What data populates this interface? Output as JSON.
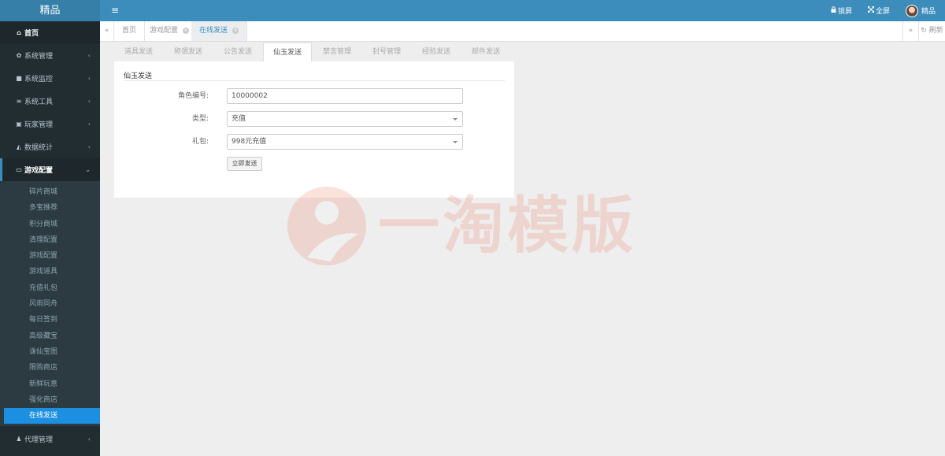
{
  "app": {
    "brand": "精品",
    "menu_icon": "≡",
    "top_actions": [
      {
        "icon": "lock-icon",
        "label": "锁屏"
      },
      {
        "icon": "expand-icon",
        "label": "全屏"
      }
    ],
    "user_name": "精品"
  },
  "sidebar": {
    "home": "首页",
    "groups": [
      {
        "label": "系统管理",
        "icon": "gear-icon"
      },
      {
        "label": "系统监控",
        "icon": "video-icon"
      },
      {
        "label": "系统工具",
        "icon": "bars-icon"
      },
      {
        "label": "玩家管理",
        "icon": "id-card-icon"
      },
      {
        "label": "数据统计",
        "icon": "area-chart-icon"
      }
    ],
    "open_group": "游戏配置",
    "sub_items": [
      "碎片商城",
      "多宝推荐",
      "积分商城",
      "清理配置",
      "游戏配置",
      "游戏道具",
      "充值礼包",
      "风雨同舟",
      "每日签到",
      "高级藏宝",
      "诛仙宝图",
      "限购商店",
      "新鲜玩意",
      "强化商店",
      "在线发送"
    ],
    "active_sub": "在线发送",
    "last_group": "代理管理"
  },
  "page_tabs": [
    {
      "label": "首页"
    },
    {
      "label": "游戏配置"
    },
    {
      "label": "在线发送"
    }
  ],
  "refresh_label": "刷新",
  "sub_tabs": [
    "道具发送",
    "称谓发送",
    "公告发送",
    "仙玉发送",
    "禁言管理",
    "封号管理",
    "经验发送",
    "邮件发送"
  ],
  "active_sub_tab": "仙玉发送",
  "form": {
    "title": "仙玉发送",
    "role_label": "角色编号:",
    "role_value": "10000002",
    "type_label": "类型:",
    "type_value": "充值",
    "gift_label": "礼包:",
    "gift_value": "998元充值",
    "submit_label": "立即发送"
  },
  "watermark": "一淘模版",
  "colors": {
    "topbar": "#3c8dbc",
    "sidebar": "#222d32",
    "active_item": "#1d8fe1"
  }
}
